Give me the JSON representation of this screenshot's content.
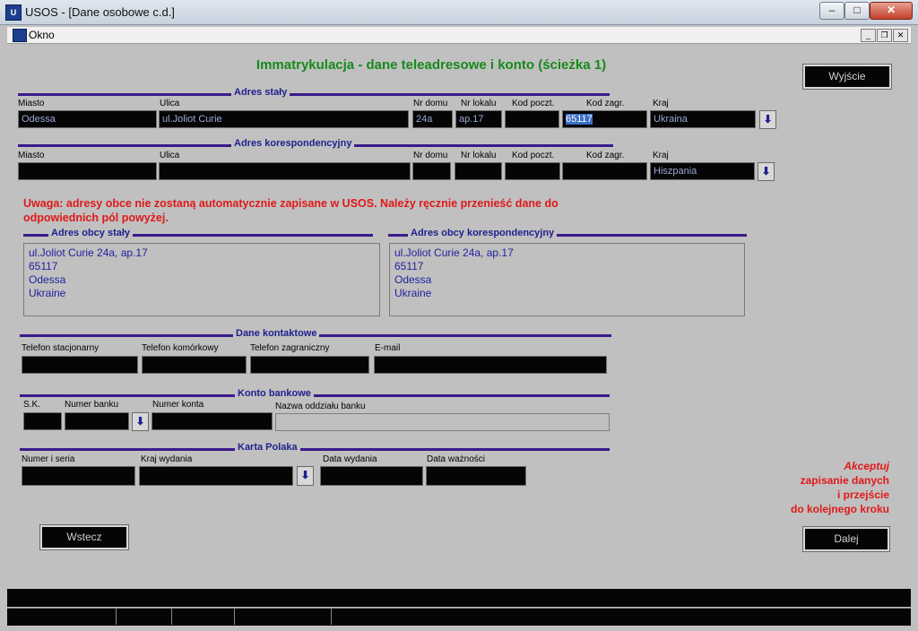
{
  "window": {
    "title": "USOS - [Dane osobowe c.d.]",
    "menu_label": "Okno"
  },
  "page_title": "Immatrykulacja - dane teleadresowe i konto (ścieżka 1)",
  "exit_label": "Wyjście",
  "adres_staly": {
    "title": "Adres stały",
    "labels": {
      "miasto": "Miasto",
      "ulica": "Ulica",
      "nr_domu": "Nr domu",
      "nr_lokalu": "Nr lokalu",
      "kod_poczt": "Kod poczt.",
      "kod_zagr": "Kod zagr.",
      "kraj": "Kraj"
    },
    "values": {
      "miasto": "Odessa",
      "ulica": "ul.Joliot Curie",
      "nr_domu": "24a",
      "nr_lokalu": "ap.17",
      "kod_poczt": "",
      "kod_zagr": "65117",
      "kraj": "Ukraina"
    }
  },
  "adres_koresp": {
    "title": "Adres korespondencyjny",
    "labels": {
      "miasto": "Miasto",
      "ulica": "Ulica",
      "nr_domu": "Nr domu",
      "nr_lokalu": "Nr lokalu",
      "kod_poczt": "Kod poczt.",
      "kod_zagr": "Kod zagr.",
      "kraj": "Kraj"
    },
    "values": {
      "miasto": "",
      "ulica": "",
      "nr_domu": "",
      "nr_lokalu": "",
      "kod_poczt": "",
      "kod_zagr": "",
      "kraj": "Hiszpania"
    }
  },
  "warning": "Uwaga: adresy obce nie zostaną automatycznie zapisane w USOS. Należy ręcznie przenieść dane do odpowiednich pól powyżej.",
  "adres_obcy_staly": {
    "title": "Adres obcy stały",
    "lines": [
      "ul.Joliot Curie 24a, ap.17",
      "65117",
      "Odessa",
      "Ukraine"
    ]
  },
  "adres_obcy_koresp": {
    "title": "Adres obcy korespondencyjny",
    "lines": [
      "ul.Joliot Curie 24a, ap.17",
      "65117",
      "Odessa",
      "Ukraine"
    ]
  },
  "dane_kontaktowe": {
    "title": "Dane kontaktowe",
    "labels": {
      "tel_stac": "Telefon stacjonarny",
      "tel_kom": "Telefon komórkowy",
      "tel_zagr": "Telefon zagraniczny",
      "email": "E-mail"
    },
    "values": {
      "tel_stac": "",
      "tel_kom": "",
      "tel_zagr": "",
      "email": ""
    }
  },
  "konto_bankowe": {
    "title": "Konto bankowe",
    "labels": {
      "sk": "S.K.",
      "numer_banku": "Numer banku",
      "numer_konta": "Numer konta",
      "nazwa_oddzialu": "Nazwa oddziału banku"
    }
  },
  "karta_polaka": {
    "title": "Karta Polaka",
    "labels": {
      "numer": "Numer i seria",
      "kraj": "Kraj wydania",
      "data_wydania": "Data wydania",
      "data_waznosci": "Data ważności"
    }
  },
  "accept": {
    "line1": "Akceptuj",
    "line2": "zapisanie danych",
    "line3": "i przejście",
    "line4": "do kolejnego kroku"
  },
  "buttons": {
    "back": "Wstecz",
    "next": "Dalej"
  },
  "icons": {
    "dropdown": "arrow-down-icon"
  }
}
